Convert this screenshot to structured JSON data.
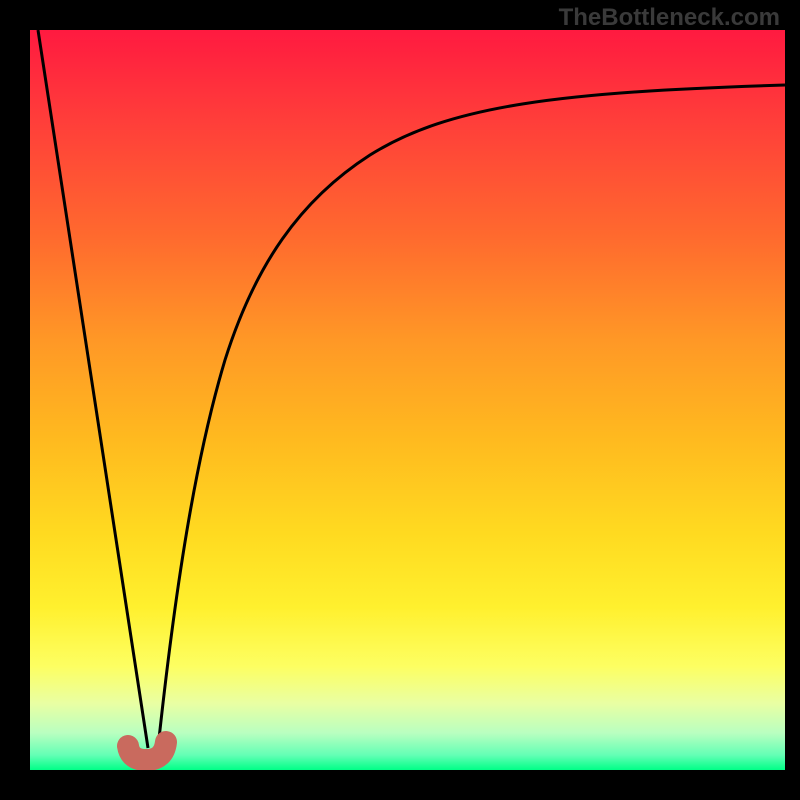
{
  "watermark": "TheBottleneck.com",
  "palette": {
    "top": "#ff1a40",
    "mid": "#ffda20",
    "bottom": "#00ff87",
    "curve": "#000000",
    "hook": "#c96a5e",
    "frame": "#000000"
  },
  "chart_data": {
    "type": "line",
    "title": "",
    "xlabel": "",
    "ylabel": "",
    "xlim": [
      0,
      100
    ],
    "ylim": [
      0,
      100
    ],
    "grid": false,
    "notes": "No axes, ticks or legend are rendered. Background is a vertical red→green heat gradient. Two black curves: a straight line descending from top-left and an asymptotic curve rising to the right, meeting near x≈15. A small salmon hook marker sits at the vertex.",
    "series": [
      {
        "name": "left-descent",
        "x": [
          0,
          3,
          6,
          9,
          12,
          15
        ],
        "values": [
          100,
          82,
          64,
          46,
          28,
          0
        ]
      },
      {
        "name": "right-ascent",
        "x": [
          15,
          18,
          21,
          25,
          30,
          36,
          44,
          54,
          66,
          80,
          100
        ],
        "values": [
          0,
          24,
          42,
          56,
          67,
          75,
          81,
          85,
          88,
          90,
          92
        ]
      }
    ],
    "marker": {
      "name": "vertex-hook",
      "x": 14,
      "y": 2
    }
  }
}
